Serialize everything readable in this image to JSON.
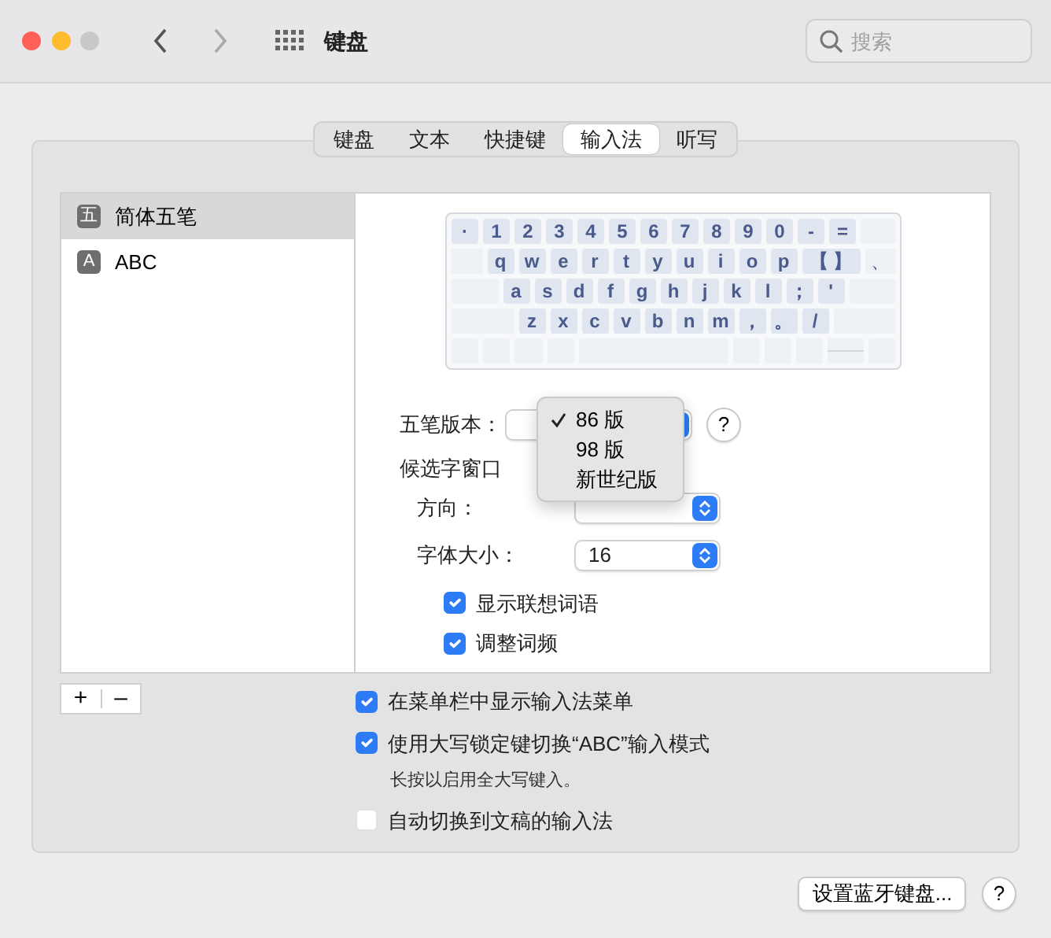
{
  "window": {
    "title": "键盘",
    "search": {
      "placeholder": "搜索"
    }
  },
  "tabs": [
    {
      "label": "键盘",
      "selected": false
    },
    {
      "label": "文本",
      "selected": false
    },
    {
      "label": "快捷键",
      "selected": false
    },
    {
      "label": "输入法",
      "selected": true
    },
    {
      "label": "听写",
      "selected": false
    }
  ],
  "input_sources": [
    {
      "icon_text": "五",
      "label": "简体五笔",
      "selected": true
    },
    {
      "icon_text": "A",
      "label": "ABC",
      "selected": false
    }
  ],
  "keyboard": {
    "rows": [
      {
        "keys": [
          {
            "label": "·"
          },
          {
            "label": "1"
          },
          {
            "label": "2"
          },
          {
            "label": "3"
          },
          {
            "label": "4"
          },
          {
            "label": "5"
          },
          {
            "label": "6"
          },
          {
            "label": "7"
          },
          {
            "label": "8"
          },
          {
            "label": "9"
          },
          {
            "label": "0"
          },
          {
            "label": "-"
          },
          {
            "label": "="
          },
          {
            "kind": "blank"
          }
        ]
      },
      {
        "keys": [
          {
            "kind": "blank"
          },
          {
            "label": "q"
          },
          {
            "label": "w"
          },
          {
            "label": "e"
          },
          {
            "label": "r"
          },
          {
            "label": "t"
          },
          {
            "label": "y"
          },
          {
            "label": "u"
          },
          {
            "label": "i"
          },
          {
            "label": "o"
          },
          {
            "label": "p"
          },
          {
            "label": "【 】",
            "kind": "wide"
          },
          {
            "label": "、",
            "kind": "faint"
          }
        ]
      },
      {
        "keys": [
          {
            "kind": "blank"
          },
          {
            "label": "a"
          },
          {
            "label": "s"
          },
          {
            "label": "d"
          },
          {
            "label": "f"
          },
          {
            "label": "g"
          },
          {
            "label": "h"
          },
          {
            "label": "j"
          },
          {
            "label": "k"
          },
          {
            "label": "l"
          },
          {
            "label": "；"
          },
          {
            "label": "'"
          },
          {
            "kind": "blank"
          }
        ]
      },
      {
        "keys": [
          {
            "kind": "blank"
          },
          {
            "label": "z"
          },
          {
            "label": "x"
          },
          {
            "label": "c"
          },
          {
            "label": "v"
          },
          {
            "label": "b"
          },
          {
            "label": "n"
          },
          {
            "label": "m"
          },
          {
            "label": "，"
          },
          {
            "label": "。"
          },
          {
            "label": "/"
          },
          {
            "kind": "blank"
          }
        ]
      },
      {
        "keys": [
          {
            "kind": "blank"
          },
          {
            "kind": "blank"
          },
          {
            "kind": "blank"
          },
          {
            "kind": "blank"
          },
          {
            "kind": "space"
          },
          {
            "kind": "blank"
          },
          {
            "kind": "blank"
          },
          {
            "kind": "blank"
          },
          {
            "kind": "arrows"
          },
          {
            "kind": "blank"
          }
        ]
      }
    ]
  },
  "wubi_version": {
    "label": "五笔版本：",
    "help": "?",
    "menu": [
      {
        "label": "86 版",
        "selected": true
      },
      {
        "label": "98 版",
        "selected": false
      },
      {
        "label": "新世纪版",
        "selected": false
      }
    ]
  },
  "candidate_window": {
    "label": "候选字窗口",
    "direction": {
      "label": "方向："
    },
    "font_size": {
      "label": "字体大小：",
      "value": "16"
    }
  },
  "panel_options": [
    {
      "label": "显示联想词语",
      "checked": true
    },
    {
      "label": "调整词频",
      "checked": true
    }
  ],
  "list_buttons": [
    "+",
    "–"
  ],
  "options": [
    {
      "label": "在菜单栏中显示输入法菜单",
      "checked": true
    },
    {
      "label": "使用大写锁定键切换“ABC”输入模式",
      "checked": true,
      "note": "长按以启用全大写键入。"
    },
    {
      "label": "自动切换到文稿的输入法",
      "checked": false
    }
  ],
  "footer": {
    "button": "设置蓝牙键盘...",
    "help": "?"
  }
}
